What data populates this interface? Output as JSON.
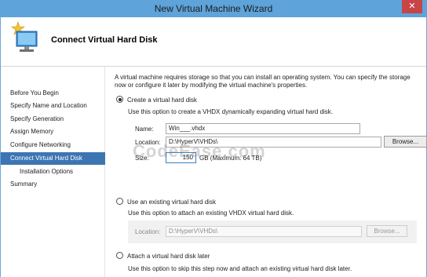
{
  "window": {
    "title": "New Virtual Machine Wizard",
    "close_glyph": "✕"
  },
  "header": {
    "title": "Connect Virtual Hard Disk",
    "icon": "vm-wizard-icon"
  },
  "nav": {
    "items": [
      {
        "label": "Before You Begin",
        "active": false,
        "sub": false
      },
      {
        "label": "Specify Name and Location",
        "active": false,
        "sub": false
      },
      {
        "label": "Specify Generation",
        "active": false,
        "sub": false
      },
      {
        "label": "Assign Memory",
        "active": false,
        "sub": false
      },
      {
        "label": "Configure Networking",
        "active": false,
        "sub": false
      },
      {
        "label": "Connect Virtual Hard Disk",
        "active": true,
        "sub": false
      },
      {
        "label": "Installation Options",
        "active": false,
        "sub": true
      },
      {
        "label": "Summary",
        "active": false,
        "sub": false
      }
    ]
  },
  "content": {
    "description": "A virtual machine requires storage so that you can install an operating system. You can specify the storage now or configure it later by modifying the virtual machine's properties.",
    "create": {
      "label": "Create a virtual hard disk",
      "checked": true,
      "hint": "Use this option to create a VHDX dynamically expanding virtual hard disk.",
      "name_label": "Name:",
      "name_value": "Win___.vhdx",
      "location_label": "Location:",
      "location_value": "D:\\HyperV\\VHDs\\",
      "browse_label": "Browse...",
      "size_label": "Size:",
      "size_value": "150",
      "size_unit": "GB (Maximum: 64 TB)"
    },
    "existing": {
      "label": "Use an existing virtual hard disk",
      "checked": false,
      "hint": "Use this option to attach an existing VHDX virtual hard disk.",
      "location_label": "Location:",
      "location_value": "D:\\HyperV\\VHDs\\",
      "browse_label": "Browse..."
    },
    "later": {
      "label": "Attach a virtual hard disk later",
      "checked": false,
      "hint": "Use this option to skip this step now and attach an existing virtual hard disk later."
    }
  },
  "watermark": "CodeEase.com",
  "colors": {
    "title_bar": "#5ea3d9",
    "nav_active": "#3c75b2",
    "close_button": "#c74447"
  }
}
